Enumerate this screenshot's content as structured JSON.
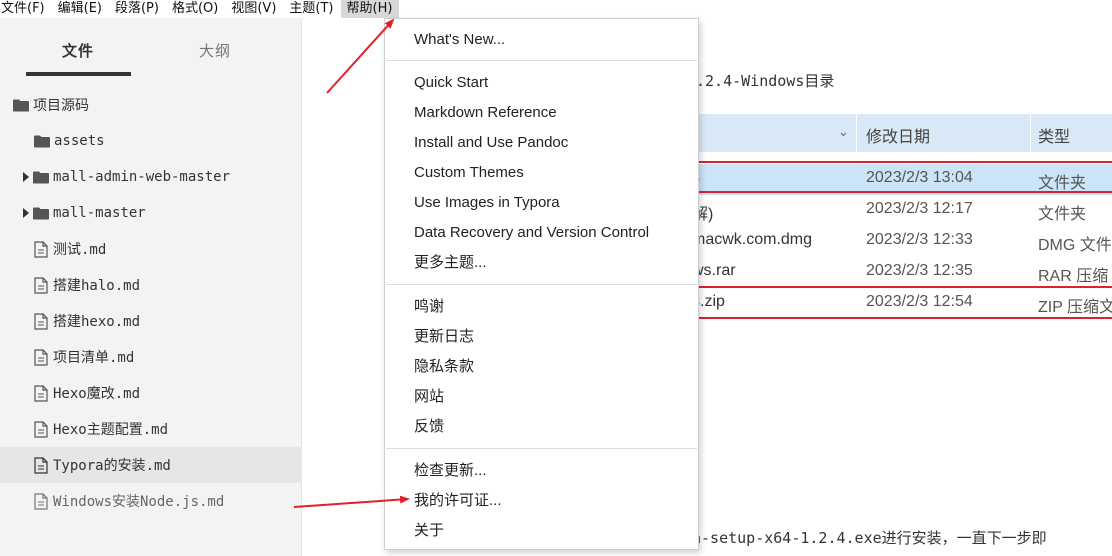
{
  "menubar": {
    "items": [
      "文件(F)",
      "编辑(E)",
      "段落(P)",
      "格式(O)",
      "视图(V)",
      "主题(T)",
      "帮助(H)"
    ]
  },
  "sidebar": {
    "tabs": [
      "文件",
      "大纲"
    ],
    "tree": [
      {
        "label": "项目源码",
        "type": "folder"
      },
      {
        "label": "assets",
        "type": "folder"
      },
      {
        "label": "mall-admin-web-master",
        "type": "folder"
      },
      {
        "label": "mall-master",
        "type": "folder"
      },
      {
        "label": "测试.md",
        "type": "file"
      },
      {
        "label": "搭建halo.md",
        "type": "file"
      },
      {
        "label": "搭建hexo.md",
        "type": "file"
      },
      {
        "label": "项目清单.md",
        "type": "file"
      },
      {
        "label": "Hexo魔改.md",
        "type": "file"
      },
      {
        "label": "Hexo主题配置.md",
        "type": "file"
      },
      {
        "label": "Typora的安装.md",
        "type": "file"
      },
      {
        "label": "Windows安装Node.js.md",
        "type": "file"
      }
    ]
  },
  "help_menu": {
    "items": [
      "What's New...",
      "Quick Start",
      "Markdown Reference",
      "Install and Use Pandoc",
      "Custom Themes",
      "Use Images in Typora",
      "Data Recovery and Version Control",
      "更多主题...",
      "鸣谢",
      "更新日志",
      "隐私条款",
      "网站",
      "反馈",
      "检查更新...",
      "我的许可证...",
      "关于"
    ]
  },
  "main": {
    "heading_fragment": ".2.4-Windows目录",
    "bottom_fragment": "a-setup-x64-1.2.4.exe进行安装，一直下一步即",
    "explorer": {
      "headers": [
        "修改日期",
        "类型"
      ],
      "rows": [
        {
          "name": "s",
          "date": "2023/2/3 13:04",
          "type": "文件夹"
        },
        {
          "name": "解)",
          "date": "2023/2/3 12:17",
          "type": "文件夹"
        },
        {
          "name": "macwk.com.dmg",
          "date": "2023/2/3 12:33",
          "type": "DMG 文件"
        },
        {
          "name": "ws.rar",
          "date": "2023/2/3 12:35",
          "type": "RAR 压缩"
        },
        {
          "name": "s.zip",
          "date": "2023/2/3 12:54",
          "type": "ZIP 压缩文"
        }
      ]
    }
  },
  "colors": {
    "accent_red": "#e0202a",
    "selection_blue": "#cce4f7",
    "header_blue": "#d9e8f6"
  }
}
